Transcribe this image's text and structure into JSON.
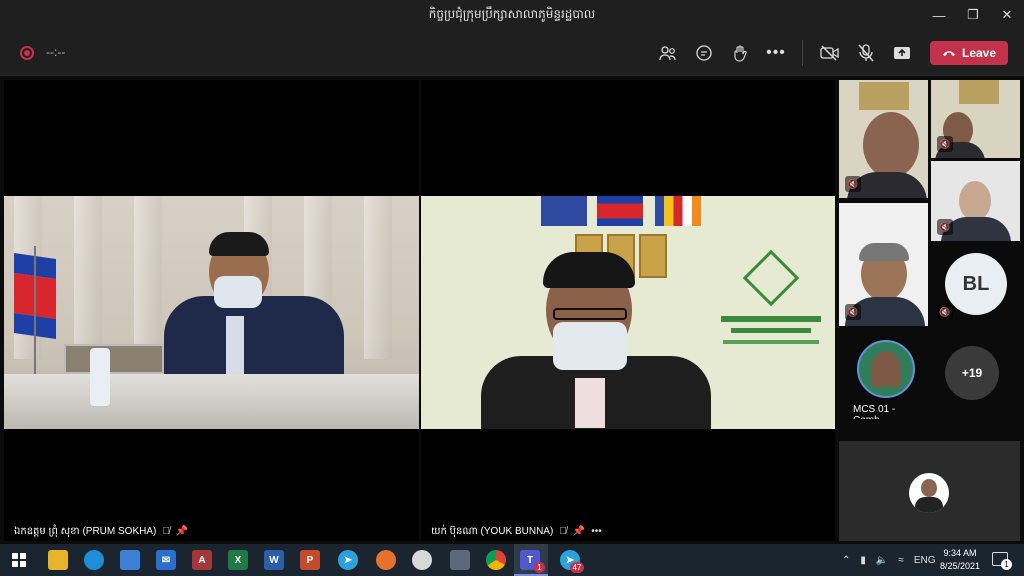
{
  "window": {
    "title": "កិច្ចប្រជុំក្រុមប្រឹក្សាសាលាភូមិន្ទរដ្ឋបាល"
  },
  "toolbar": {
    "timer": "--:--",
    "leave_label": "Leave"
  },
  "tiles": {
    "main_left": {
      "name": "ឯកឧត្តម ព្រុំ សុខា (PRUM SOKHA)"
    },
    "main_right": {
      "name": "យក់ ប៊ុនណា (YOUK BUNNA)"
    }
  },
  "strip": {
    "bl_initials": "BL",
    "overflow_count": "+19",
    "mcs_label": "MCS 01 - Camb..."
  },
  "taskbar": {
    "lang": "ENG",
    "time": "9:34 AM",
    "date": "8/25/2021",
    "teams_badge": "1",
    "telegram_badge": "47",
    "notif_badge": "1"
  },
  "colors": {
    "leave": "#c4314b",
    "taskbar": "#1b2530",
    "background": "#0f0f0f"
  }
}
